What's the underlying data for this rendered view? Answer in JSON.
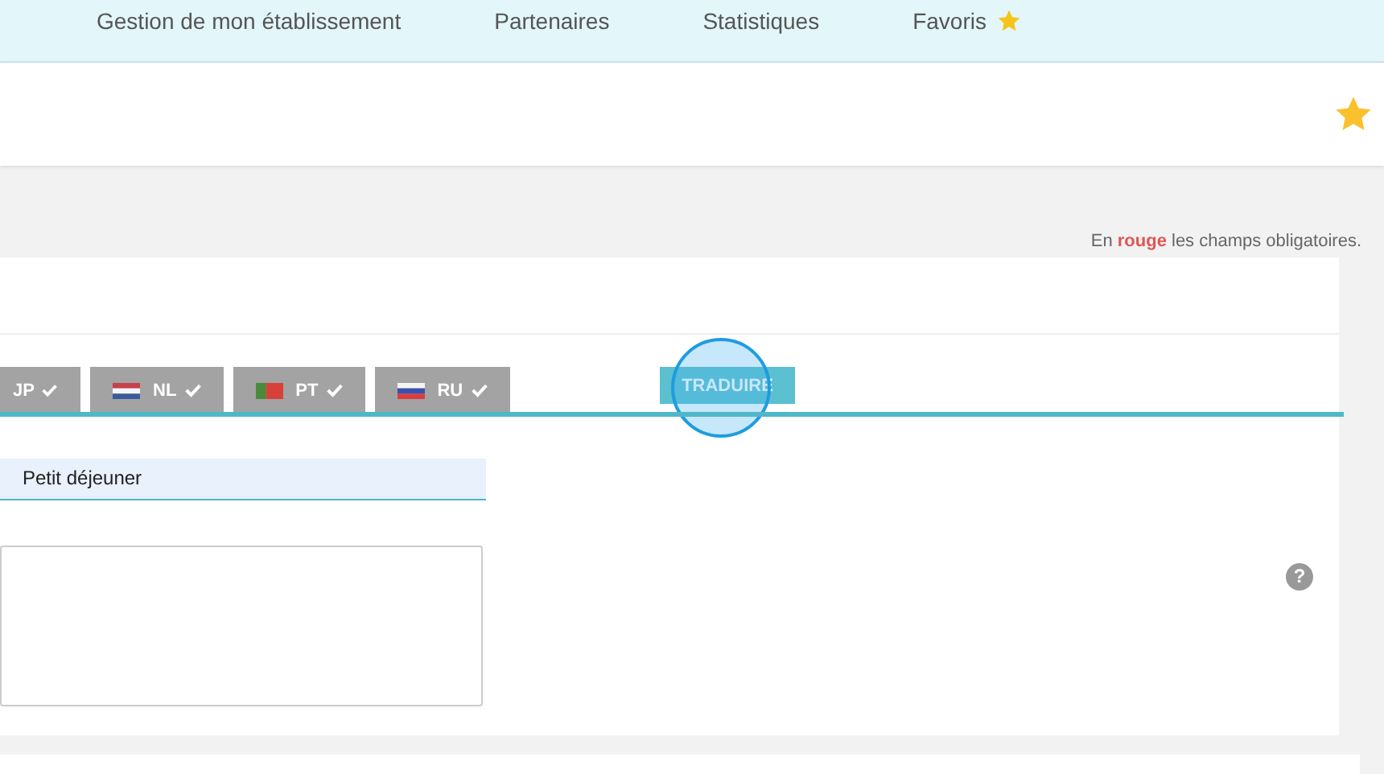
{
  "nav": {
    "items": [
      {
        "label": "Gestion de mon établissement",
        "starred": false
      },
      {
        "label": "Partenaires",
        "starred": false
      },
      {
        "label": "Statistiques",
        "starred": false
      },
      {
        "label": "Favoris",
        "starred": true
      }
    ]
  },
  "header": {
    "favorite": true
  },
  "note": "En **rouge** les champs obligatoires.",
  "language_tabs": [
    {
      "code": "JP",
      "translated": true,
      "selected": false
    },
    {
      "code": "NL",
      "translated": true,
      "selected": false
    },
    {
      "code": "PT",
      "translated": true,
      "selected": false
    },
    {
      "code": "RU",
      "translated": true,
      "selected": false
    }
  ],
  "translate_button": "TRADUIRE",
  "name_field": {
    "value": "Petit déjeuner"
  },
  "help": "?"
}
